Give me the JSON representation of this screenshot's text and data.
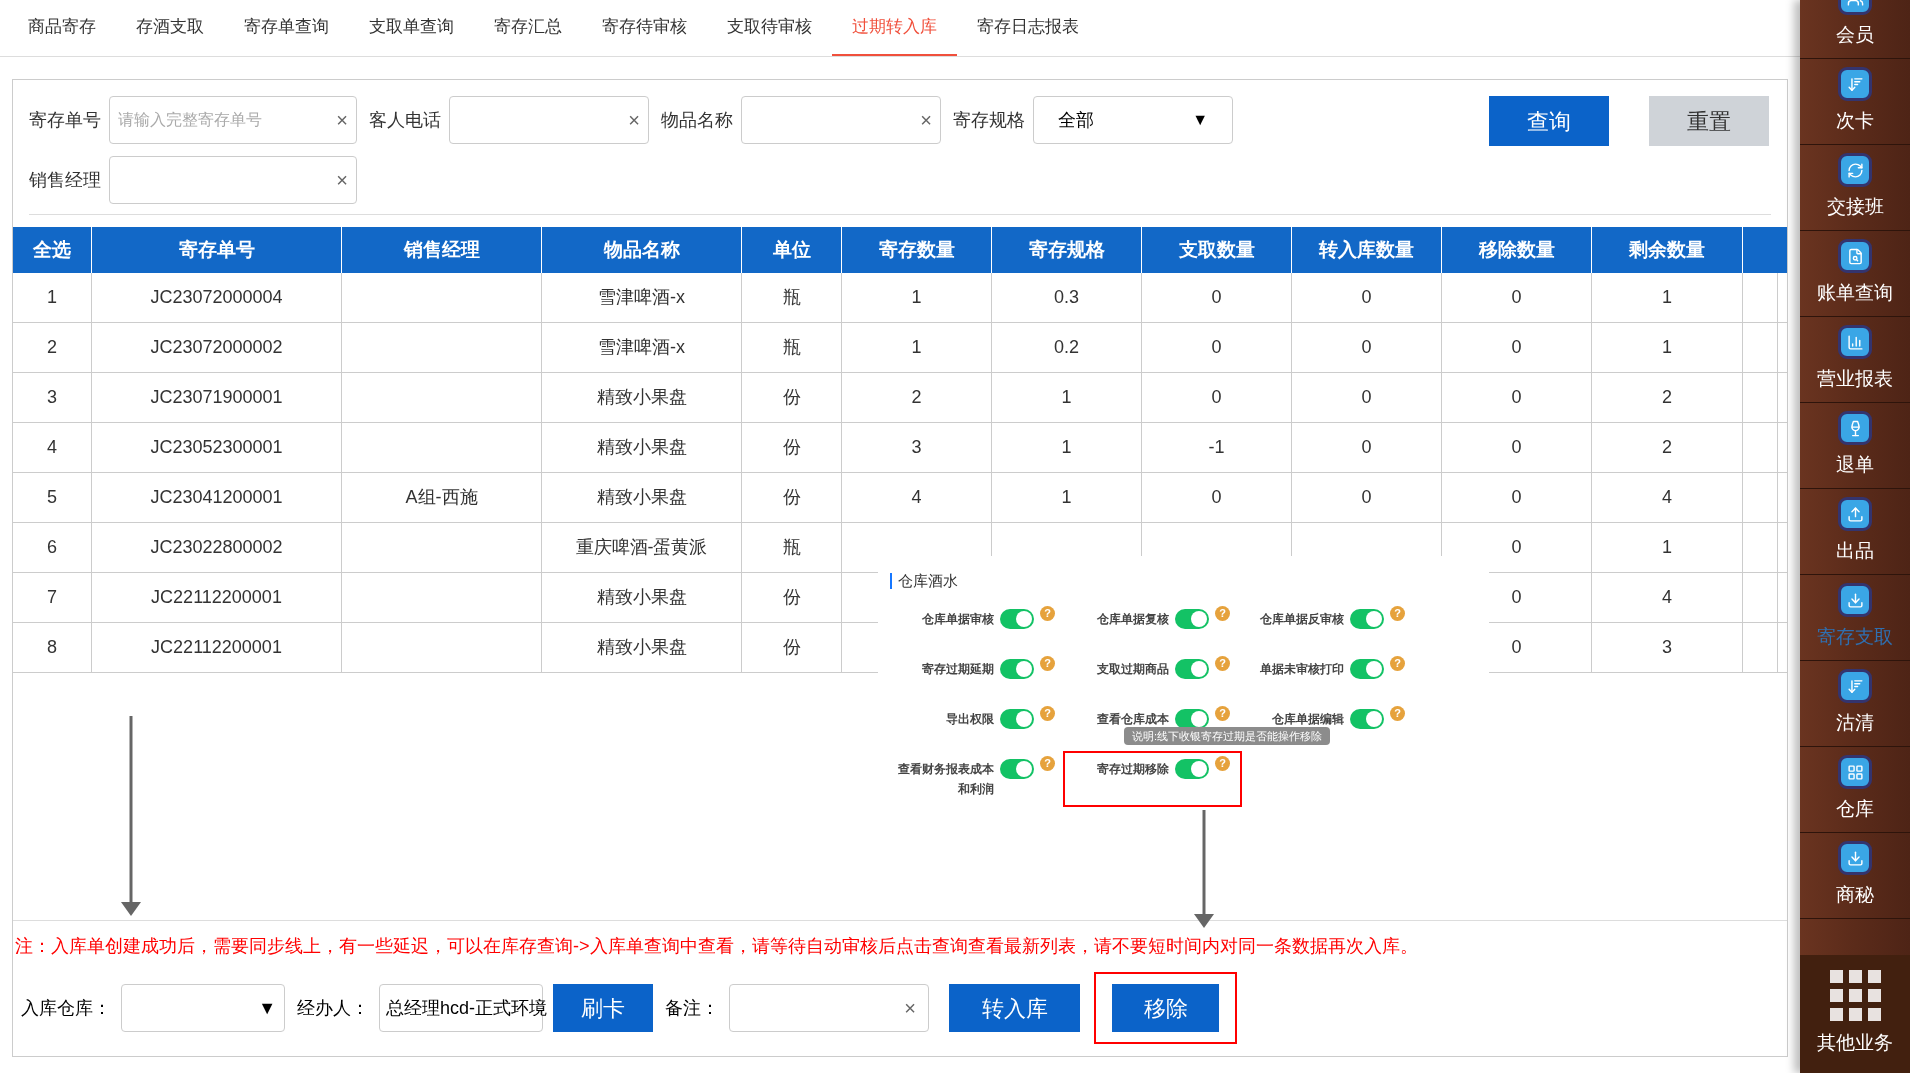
{
  "tabs": [
    {
      "label": "商品寄存",
      "selected": false
    },
    {
      "label": "存酒支取",
      "selected": false
    },
    {
      "label": "寄存单查询",
      "selected": false
    },
    {
      "label": "支取单查询",
      "selected": false
    },
    {
      "label": "寄存汇总",
      "selected": false
    },
    {
      "label": "寄存待审核",
      "selected": false
    },
    {
      "label": "支取待审核",
      "selected": false
    },
    {
      "label": "过期转入库",
      "selected": true
    },
    {
      "label": "寄存日志报表",
      "selected": false
    }
  ],
  "filters": [
    {
      "kind": "input",
      "label": "寄存单号",
      "placeholder": "请输入完整寄存单号",
      "clear": "×"
    },
    {
      "kind": "input",
      "label": "客人电话",
      "clear": "×"
    },
    {
      "kind": "input",
      "label": "物品名称",
      "clear": "×"
    },
    {
      "kind": "select",
      "label": "寄存规格",
      "value": "全部",
      "caret": "▼"
    },
    {
      "kind": "input",
      "label": "销售经理",
      "clear": "×"
    }
  ],
  "query_button": "查询",
  "reset_button": "重置",
  "table": {
    "columns": [
      "全选",
      "寄存单号",
      "销售经理",
      "物品名称",
      "单位",
      "寄存数量",
      "寄存规格",
      "支取数量",
      "转入库数量",
      "移除数量",
      "剩余数量"
    ],
    "rows": [
      [
        "1",
        "JC23072000004",
        "",
        "雪津啤酒-x",
        "瓶",
        "1",
        "0.3",
        "0",
        "0",
        "0",
        "1"
      ],
      [
        "2",
        "JC23072000002",
        "",
        "雪津啤酒-x",
        "瓶",
        "1",
        "0.2",
        "0",
        "0",
        "0",
        "1"
      ],
      [
        "3",
        "JC23071900001",
        "",
        "精致小果盘",
        "份",
        "2",
        "1",
        "0",
        "0",
        "0",
        "2"
      ],
      [
        "4",
        "JC23052300001",
        "",
        "精致小果盘",
        "份",
        "3",
        "1",
        "-1",
        "0",
        "0",
        "2"
      ],
      [
        "5",
        "JC23041200001",
        "A组-西施",
        "精致小果盘",
        "份",
        "4",
        "1",
        "0",
        "0",
        "0",
        "4"
      ],
      [
        "6",
        "JC23022800002",
        "",
        "重庆啤酒-蛋黄派",
        "瓶",
        "",
        "",
        "",
        "",
        "0",
        "1"
      ],
      [
        "7",
        "JC22112200001",
        "",
        "精致小果盘",
        "份",
        "",
        "",
        "",
        "",
        "0",
        "4"
      ],
      [
        "8",
        "JC22112200001",
        "",
        "精致小果盘",
        "份",
        "",
        "",
        "",
        "",
        "0",
        "3"
      ]
    ]
  },
  "settings_panel": {
    "title": "仓库酒水",
    "help": "?",
    "items": [
      {
        "label": "仓库单据审核",
        "on": true,
        "highlighted": false
      },
      {
        "label": "仓库单据复核",
        "on": true,
        "highlighted": false
      },
      {
        "label": "仓库单据反审核",
        "on": true,
        "highlighted": false
      },
      {
        "label": "寄存过期延期",
        "on": true,
        "highlighted": false
      },
      {
        "label": "支取过期商品",
        "on": true,
        "highlighted": false
      },
      {
        "label": "单据未审核打印",
        "on": true,
        "highlighted": false
      },
      {
        "label": "导出权限",
        "on": true,
        "highlighted": false
      },
      {
        "label": "查看仓库成本",
        "on": true,
        "highlighted": false
      },
      {
        "label": "仓库单据编辑",
        "on": true,
        "highlighted": false
      },
      {
        "label": "查看财务报表成本和利润",
        "on": true,
        "highlighted": false
      },
      {
        "label": "寄存过期移除",
        "on": true,
        "highlighted": true
      }
    ],
    "tooltip": "说明:线下收银寄存过期是否能操作移除"
  },
  "note": "注：入库单创建成功后，需要同步线上，有一些延迟，可以在库存查询->入库单查询中查看，请等待自动审核后点击查询查看最新列表，请不要短时间内对同一条数据再次入库。",
  "bottom": {
    "warehouse_label": "入库仓库：",
    "warehouse_caret": "▼",
    "handler_label": "经办人：",
    "handler_value": "总经理hcd-正式环境",
    "swipe_button": "刷卡",
    "remark_label": "备注：",
    "remark_clear": "×",
    "transfer_button": "转入库",
    "remove_button": "移除",
    "remove_highlighted": true
  },
  "sidebar": [
    {
      "label": "会员",
      "selected": false
    },
    {
      "label": "次卡",
      "selected": false
    },
    {
      "label": "交接班",
      "selected": false
    },
    {
      "label": "账单查询",
      "selected": false
    },
    {
      "label": "营业报表",
      "selected": false
    },
    {
      "label": "退单",
      "selected": false
    },
    {
      "label": "出品",
      "selected": false
    },
    {
      "label": "寄存支取",
      "selected": true
    },
    {
      "label": "沽清",
      "selected": false
    },
    {
      "label": "仓库",
      "selected": false
    },
    {
      "label": "商秘",
      "selected": false
    }
  ],
  "other_business": "其他业务"
}
